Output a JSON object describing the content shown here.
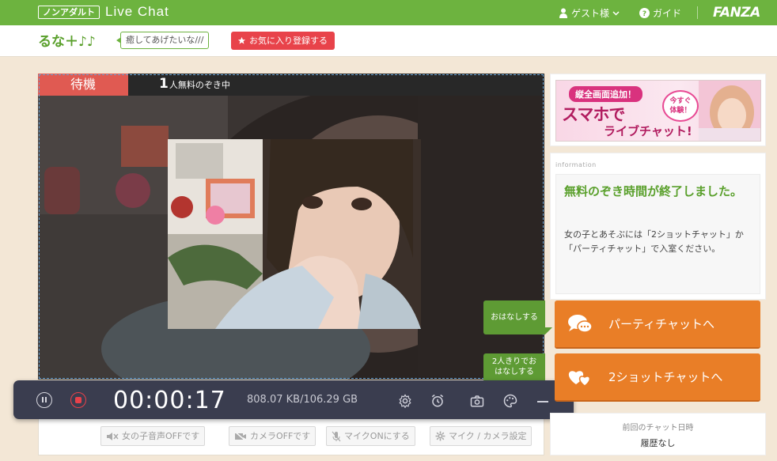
{
  "header": {
    "badge": "ノンアダルト",
    "title": "Live Chat",
    "guest_label": "ゲスト様",
    "guide_label": "ガイド",
    "brand": "FANZA"
  },
  "performer": {
    "name": "るな＋♪♪",
    "tagline": "癒してあげたいな///",
    "favorite_label": "お気に入り登録する"
  },
  "stage": {
    "status": "待機",
    "viewer_count": "1",
    "viewer_suffix": "人無料のぞき中",
    "tab_talk": "おはなしする",
    "tab_2shot_line1": "2人きりでお",
    "tab_2shot_line2": "はなしする"
  },
  "controls": {
    "mute_girl": "女の子音声OFFです",
    "camera": "カメラOFFです",
    "mic": "マイクONにする",
    "mic_camera_settings": "マイク / カメラ設定"
  },
  "recorder": {
    "timer": "00:00:17",
    "size": "808.07 KB/106.29 GB"
  },
  "banner": {
    "top": "縦全画面追加！",
    "main": "スマホで",
    "main2": "ライブチャット!",
    "bubble_line1": "今すぐ",
    "bubble_line2": "体験！"
  },
  "info": {
    "label": "information",
    "title": "無料のぞき時間が終了しました。",
    "body": "女の子とあそぶには「2ショットチャット」か「パーティチャット」で入室ください。"
  },
  "cta": {
    "party": "パーティチャットへ",
    "two_shot": "2ショットチャットへ"
  },
  "history": {
    "label": "前回のチャット日時",
    "value": "履歴なし"
  },
  "colors": {
    "header_green": "#6db33f",
    "accent_orange": "#e97e27",
    "status_red": "#e05a52",
    "favorite_red": "#e8434a"
  }
}
